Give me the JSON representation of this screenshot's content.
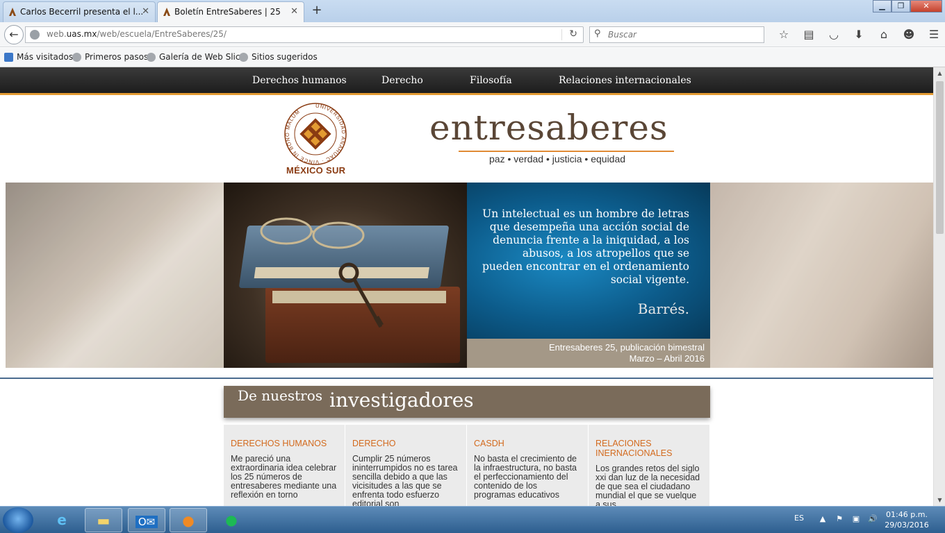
{
  "browser": {
    "tabs": [
      {
        "title": "Carlos Becerril presenta el l...",
        "active": false
      },
      {
        "title": "Boletín EntreSaberes | 25",
        "active": true
      }
    ],
    "url_prefix": "web.",
    "url_domain": "uas.mx",
    "url_path": "/web/escuela/EntreSaberes/25/",
    "search_placeholder": "Buscar",
    "bookmarks": [
      "Más visitados",
      "Primeros pasos",
      "Galería de Web Slice",
      "Sitios sugeridos"
    ]
  },
  "site_nav": [
    "Derechos humanos",
    "Derecho",
    "Filosofía",
    "Relaciones internacionales"
  ],
  "logo": {
    "seal_caption": "MÉXICO SUR",
    "seal_ring_text": "UNIVERSIDAD ANÁHUAC · VINCE IN BONO MALUM",
    "brand": "entresaberes",
    "tagline": "paz • verdad • justicia • equidad"
  },
  "banner": {
    "quote": "Un intelectual es un hombre de letras que desempeña una acción social de denuncia frente a la iniquidad, a los abusos, a los atropellos que se pueden encontrar en el ordenamiento social vigente.",
    "author": "Barrés.",
    "edition_line1": "Entresaberes 25, publicación bimestral",
    "edition_line2": "Marzo – Abril 2016"
  },
  "research": {
    "header_small": "De nuestros",
    "header_large": "investigadores",
    "columns": [
      {
        "title": "DERECHOS HUMANOS",
        "text": "Me pareció una extraordinaria idea celebrar los 25 números de entresaberes mediante una reflexión en torno"
      },
      {
        "title": "DERECHO",
        "text": "Cumplir 25 números ininterrumpidos no es tarea sencilla debido a que las vicisitudes a las que se enfrenta todo esfuerzo editorial son"
      },
      {
        "title": "CASDH",
        "text": "No basta el crecimiento de la infraestructura, no basta el perfeccionamiento del contenido de los programas educativos"
      },
      {
        "title": "RELACIONES INERNACIONALES",
        "text": "Los grandes retos del siglo xxi dan luz de la necesidad de que sea el ciudadano mundial el que se vuelque a sus"
      }
    ]
  },
  "taskbar": {
    "language": "ES",
    "time": "01:46 p.m.",
    "date": "29/03/2016"
  },
  "colors": {
    "nav_accent": "#e39b32",
    "quote_blue": "#0c5b8a",
    "research_header": "#7a6b5a",
    "column_title": "#d36a1e"
  }
}
